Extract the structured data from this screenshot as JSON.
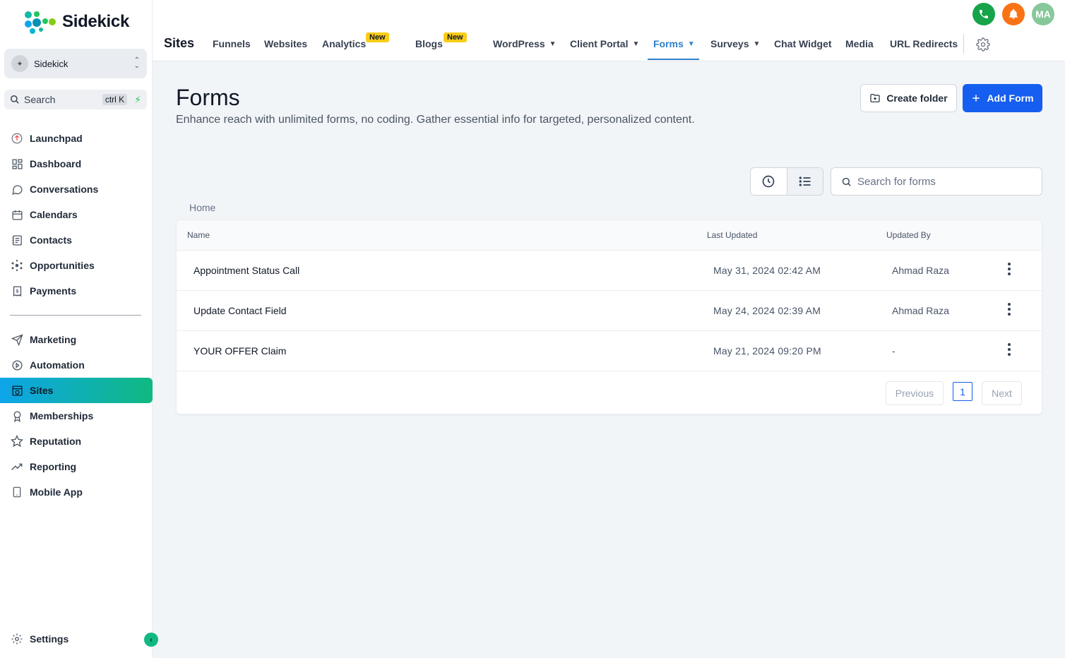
{
  "brand": {
    "name": "Sidekick"
  },
  "account": {
    "name": "Sidekick"
  },
  "sidebar_search": {
    "label": "Search",
    "shortcut": "ctrl K"
  },
  "nav": {
    "primary": [
      {
        "label": "Launchpad",
        "icon": "launchpad-icon"
      },
      {
        "label": "Dashboard",
        "icon": "dashboard-icon"
      },
      {
        "label": "Conversations",
        "icon": "chat-icon"
      },
      {
        "label": "Calendars",
        "icon": "calendar-icon"
      },
      {
        "label": "Contacts",
        "icon": "contacts-icon"
      },
      {
        "label": "Opportunities",
        "icon": "opportunities-icon"
      },
      {
        "label": "Payments",
        "icon": "payments-icon"
      }
    ],
    "secondary": [
      {
        "label": "Marketing",
        "icon": "send-icon"
      },
      {
        "label": "Automation",
        "icon": "automation-icon"
      },
      {
        "label": "Sites",
        "icon": "sites-icon",
        "active": true
      },
      {
        "label": "Memberships",
        "icon": "award-icon"
      },
      {
        "label": "Reputation",
        "icon": "star-icon"
      },
      {
        "label": "Reporting",
        "icon": "trend-icon"
      },
      {
        "label": "Mobile App",
        "icon": "mobile-icon"
      }
    ],
    "settings": "Settings"
  },
  "header": {
    "section": "Sites",
    "tabs": [
      {
        "label": "Funnels"
      },
      {
        "label": "Websites"
      },
      {
        "label": "Analytics",
        "badge": "New"
      },
      {
        "label": "Blogs",
        "badge": "New"
      },
      {
        "label": "WordPress",
        "dropdown": true
      },
      {
        "label": "Client Portal",
        "dropdown": true
      },
      {
        "label": "Forms",
        "dropdown": true,
        "active": true
      },
      {
        "label": "Surveys",
        "dropdown": true
      },
      {
        "label": "Chat Widget"
      },
      {
        "label": "Media"
      },
      {
        "label": "URL Redirects"
      }
    ],
    "user_initials": "MA",
    "colors": {
      "phone": "#16a34a",
      "bell": "#f97316",
      "avatar": "#86c89a",
      "active_tab": "#2f80c9"
    }
  },
  "page": {
    "title": "Forms",
    "subtitle": "Enhance reach with unlimited forms, no coding. Gather essential info for targeted, personalized content.",
    "create_folder": "Create folder",
    "add_form": "Add Form",
    "search_placeholder": "Search for forms",
    "breadcrumb": "Home"
  },
  "table": {
    "columns": [
      "Name",
      "Last Updated",
      "Updated By"
    ],
    "rows": [
      {
        "name": "Appointment Status Call",
        "updated": "May 31, 2024 02:42 AM",
        "by": "Ahmad Raza"
      },
      {
        "name": "Update Contact Field",
        "updated": "May 24, 2024 02:39 AM",
        "by": "Ahmad Raza"
      },
      {
        "name": "YOUR OFFER Claim",
        "updated": "May 21, 2024 09:20 PM",
        "by": "-"
      }
    ],
    "pagination": {
      "previous": "Previous",
      "current": "1",
      "next": "Next"
    }
  }
}
